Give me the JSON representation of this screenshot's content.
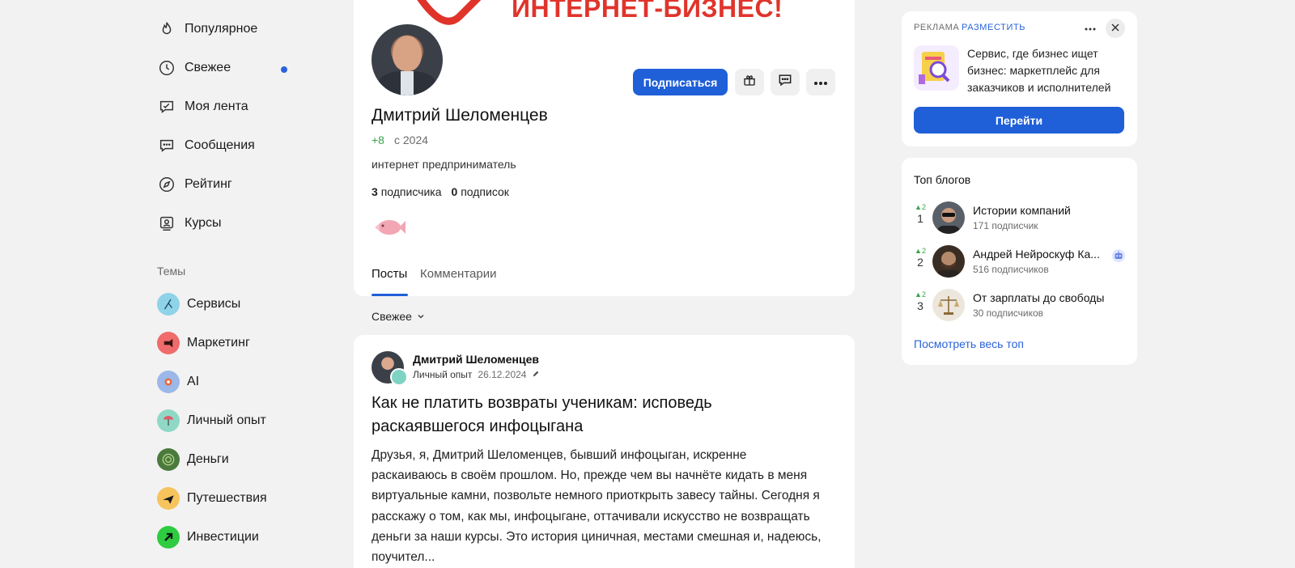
{
  "sidebar": {
    "nav": [
      {
        "label": "Популярное",
        "icon": "flame-icon"
      },
      {
        "label": "Свежее",
        "icon": "clock-icon",
        "has_dot": true
      },
      {
        "label": "Моя лента",
        "icon": "feed-icon"
      },
      {
        "label": "Сообщения",
        "icon": "message-icon"
      },
      {
        "label": "Рейтинг",
        "icon": "compass-icon"
      },
      {
        "label": "Курсы",
        "icon": "courses-icon"
      }
    ],
    "themes_title": "Темы",
    "topics": [
      {
        "label": "Сервисы",
        "color": "#8fd3e8"
      },
      {
        "label": "Маркетинг",
        "color": "#f06b6b"
      },
      {
        "label": "AI",
        "color": "#9bb8e8"
      },
      {
        "label": "Личный опыт",
        "color": "#8fd8c6"
      },
      {
        "label": "Деньги",
        "color": "#4a7a3c"
      },
      {
        "label": "Путешествия",
        "color": "#f6c35c"
      },
      {
        "label": "Инвестиции",
        "color": "#2ecc40"
      }
    ]
  },
  "banner": {
    "text": "ИНТЕРНЕТ-БИЗНЕС!"
  },
  "profile": {
    "name": "Дмитрий Шеломенцев",
    "karma": "+8",
    "since": "с 2024",
    "bio": "интернет предприниматель",
    "followers_count": "3",
    "followers_label": "подписчика",
    "following_count": "0",
    "following_label": "подписок",
    "subscribe_label": "Подписаться",
    "tabs": [
      "Посты",
      "Комментарии"
    ]
  },
  "feed": {
    "sort_label": "Свежее"
  },
  "post": {
    "author": "Дмитрий Шеломенцев",
    "topic": "Личный опыт",
    "date": "26.12.2024",
    "title": "Как не платить возвраты ученикам: исповедь раскаявшегося инфоцыгана",
    "body": "Друзья, я, Дмитрий Шеломенцев, бывший инфоцыган, искренне раскаиваюсь в своём прошлом. Но, прежде чем вы начнёте кидать в меня виртуальные камни, позвольте немного приоткрыть завесу тайны. Сегодня я расскажу о том, как мы, инфоцыгане, оттачивали искусство не возвращать деньги за наши курсы. Это история циничная, местами смешная и, надеюсь, поучител..."
  },
  "ad": {
    "label": "РЕКЛАМА",
    "place_label": "РАЗМЕСТИТЬ",
    "text": "Сервис, где бизнес ищет бизнес: маркетплейс для заказчиков и исполнителей",
    "button": "Перейти"
  },
  "top_blogs": {
    "title": "Топ блогов",
    "items": [
      {
        "rank": "1",
        "change": "▲2",
        "name": "Истории компаний",
        "subs": "171 подписчик"
      },
      {
        "rank": "2",
        "change": "▲2",
        "name": "Андрей Нейроскуф Ка...",
        "subs": "516 подписчиков"
      },
      {
        "rank": "3",
        "change": "▲2",
        "name": "От зарплаты до свободы",
        "subs": "30 подписчиков"
      }
    ],
    "see_all": "Посмотреть весь топ"
  }
}
